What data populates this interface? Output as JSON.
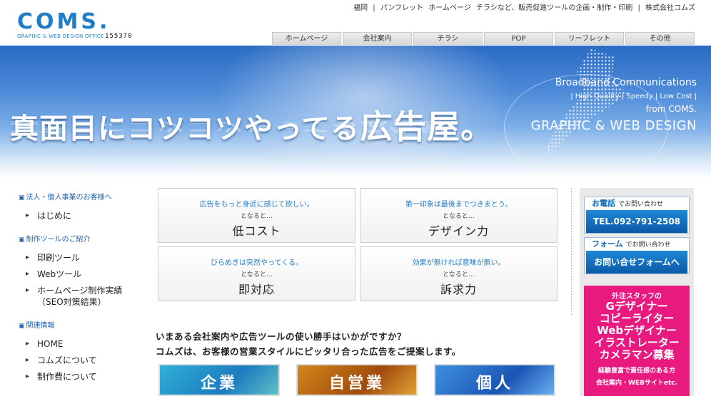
{
  "header": {
    "logo_text": "COMS.",
    "logo_sub": "GRAPHIC & WEB DESIGN OFFICE",
    "counter": "155370",
    "top_links": [
      "福岡",
      "|",
      "パンフレット",
      "ホームページ",
      "チラシなど、販売促進ツールの企画・制作・印刷",
      "|",
      "株式会社コムズ"
    ],
    "tabs": [
      "ホームページ",
      "会社案内",
      "チラシ",
      "POP",
      "リーフレット",
      "その他"
    ]
  },
  "hero": {
    "headline_a": "真面目にコツコツやってる",
    "headline_b": "広告屋。",
    "line1": "Broadband Communications",
    "line2": "| High Quality | Speedy | Low Cost |",
    "line3": "from COMS.",
    "line4": "GRAPHIC & WEB DESIGN"
  },
  "sidebar": {
    "sections": [
      {
        "title": "法人・個人事業のお客様へ",
        "items": [
          "はじめに"
        ]
      },
      {
        "title": "制作ツールのご紹介",
        "items": [
          "印刷ツール",
          "Webツール",
          "ホームページ制作実績（SEO対策結果）"
        ]
      },
      {
        "title": "関連情報",
        "items": [
          "HOME",
          "コムズについて",
          "制作費について"
        ]
      }
    ]
  },
  "features": [
    {
      "question": "広告をもっと身近に感じて欲しい。",
      "then": "となると…",
      "keyword": "低コスト"
    },
    {
      "question": "第一印象は最後までつきまとう。",
      "then": "となると…",
      "keyword": "デザイン力"
    },
    {
      "question": "ひらめきは突然やってくる。",
      "then": "となると…",
      "keyword": "即対応"
    },
    {
      "question": "効果が無ければ意味が無い。",
      "then": "となると…",
      "keyword": "訴求力"
    }
  ],
  "intro": {
    "line1": "いまある会社案内や広告ツールの使い勝手はいかがですか？",
    "line2": "コムズは、お客様の営業スタイルにピッタリ合った広告をご提案します。"
  },
  "categories": [
    "企業",
    "自営業",
    "個人"
  ],
  "contact": {
    "phone_title": "お電話",
    "phone_sub": "でお問い合わせ",
    "phone_number": "TEL.092-791-2508",
    "form_title": "フォーム",
    "form_sub": "でお問い合わせ",
    "form_button": "お問い合せフォームへ"
  },
  "recruit": {
    "lead": "外注スタッフの",
    "roles": [
      "Gデザイナー",
      "コピーライター",
      "Webデザイナー",
      "イラストレーター",
      "カメラマン募集"
    ],
    "note": "経験豊富で責任感のある方",
    "note2": "会社案内・WEBサイトetc."
  },
  "colors": {
    "brand_blue": "#1e7dc9",
    "recruit_pink": "#e8197f"
  }
}
